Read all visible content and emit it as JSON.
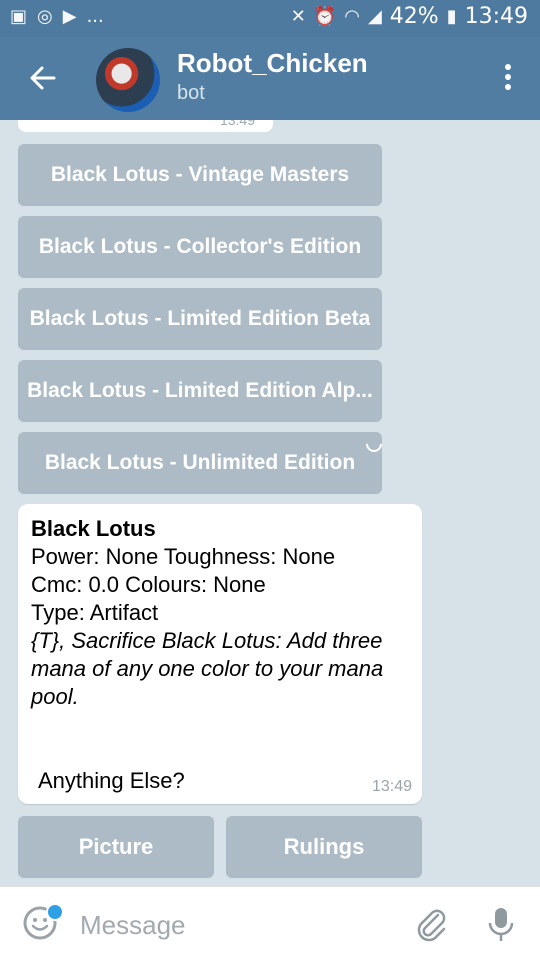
{
  "status_bar": {
    "ellipsis": "...",
    "battery_percent": "42%",
    "time": "13:49",
    "icons": [
      "image-icon",
      "whatsapp-icon",
      "play-icon",
      "mute-icon",
      "alarm-icon",
      "wifi-icon",
      "signal-icon",
      "battery-icon"
    ]
  },
  "header": {
    "title": "Robot_Chicken",
    "subtitle": "bot",
    "icons": [
      "back-arrow-icon",
      "avatar",
      "more-vert-icon"
    ]
  },
  "previous_message": {
    "time": "13:49"
  },
  "keyboard_buttons": [
    "Black Lotus - Vintage Masters",
    "Black Lotus - Collector's Edition",
    "Black Lotus - Limited Edition Beta",
    "Black Lotus - Limited Edition Alp...",
    "Black Lotus - Unlimited Edition"
  ],
  "message": {
    "name": "Black Lotus",
    "line1": "Power: None Toughness: None",
    "line2": "Cmc: 0.0 Colours: None",
    "line3": "Type: Artifact",
    "text1": "{T}, Sacrifice Black Lotus: Add three",
    "text2": "mana of any one color to your mana",
    "text3": "pool.",
    "footer": "Anything Else?",
    "time": "13:49"
  },
  "inline_buttons": {
    "picture": "Picture",
    "rulings": "Rulings"
  },
  "input": {
    "placeholder": "Message",
    "icons": [
      "emoji-icon",
      "attach-icon",
      "mic-icon"
    ]
  },
  "colors": {
    "header": "#527da3",
    "status_bar": "#4f7aa0",
    "accent": "#2f9fe6"
  }
}
